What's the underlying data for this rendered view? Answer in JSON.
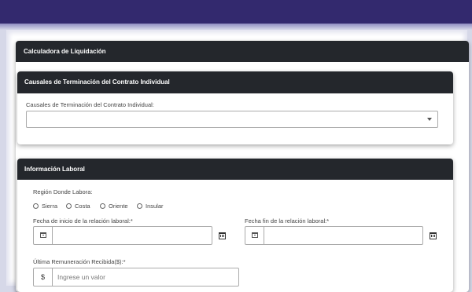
{
  "colors": {
    "header": "#24272c",
    "top_band": "#33296e"
  },
  "main_card": {
    "title": "Calculadora de Liquidación"
  },
  "termination_card": {
    "title": "Causales de Terminación del Contrato Individual",
    "field_label": "Causales de Terminación del Contrato Individual:",
    "selected_value": ""
  },
  "work_card": {
    "title": "Información Laboral",
    "region_label": "Región Donde Labora:",
    "regions": [
      "Sierra",
      "Costa",
      "Oriente",
      "Insular"
    ],
    "start_date_label": "Fecha de inicio de la relación laboral:*",
    "end_date_label": "Fecha fin de la relación laboral:*",
    "salary_label": "Última Remuneración Recibida($):*",
    "currency_symbol": "$",
    "salary_placeholder": "Ingrese un valor"
  },
  "icons": [
    "calendar-icon",
    "chevron-down-icon",
    "radio-icon"
  ]
}
